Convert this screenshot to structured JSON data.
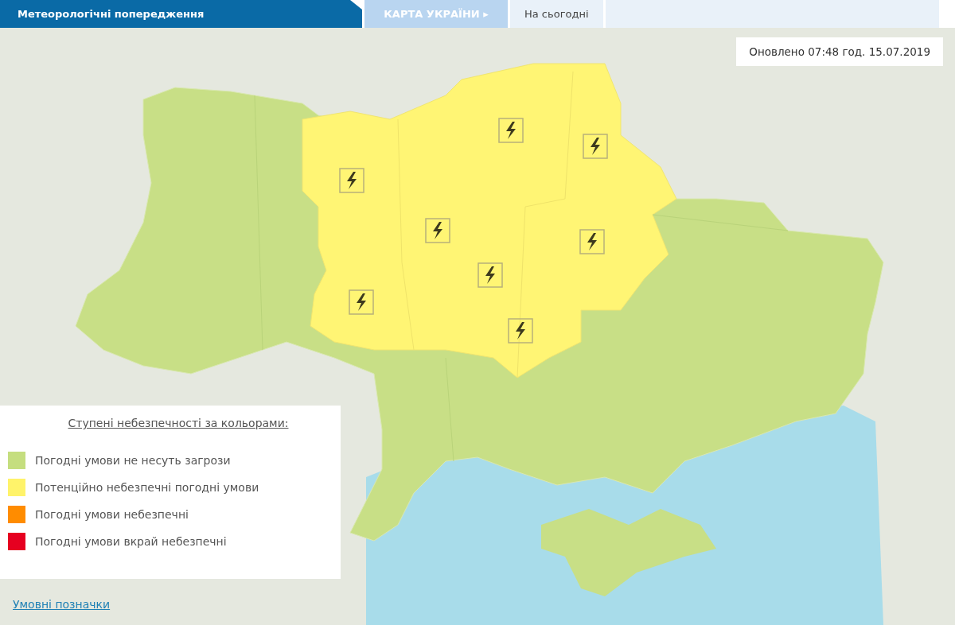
{
  "header": {
    "title": "Метеорологічні попередження",
    "tabs": [
      {
        "label": "КАРТА УКРАЇНИ",
        "arrow": "▸",
        "selected": false
      },
      {
        "label": "На сьогодні",
        "selected": true
      }
    ]
  },
  "updated": "Оновлено 07:48 год. 15.07.2019",
  "legend": {
    "title": "Ступені небезпечності за кольорами:",
    "items": [
      {
        "label": "Погодні умови не несуть загрози",
        "color": "#c5de7f"
      },
      {
        "label": "Потенційно небезпечні погодні умови",
        "color": "#fff36a"
      },
      {
        "label": "Погодні умови небезпечні",
        "color": "#ff8c00"
      },
      {
        "label": "Погодні умови вкрай небезпечні",
        "color": "#e60020"
      }
    ]
  },
  "legend_link": "Умовні позначки"
}
